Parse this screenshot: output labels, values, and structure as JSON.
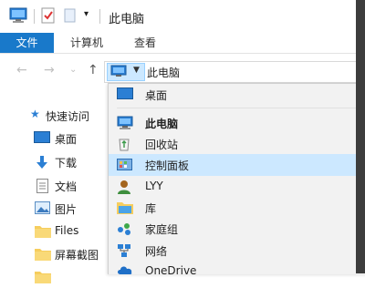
{
  "window": {
    "title": "此电脑"
  },
  "ribbon": {
    "tabs": [
      {
        "label": "文件"
      },
      {
        "label": "计算机"
      },
      {
        "label": "查看"
      }
    ]
  },
  "address": {
    "path": "此电脑"
  },
  "nav_pane": {
    "items": [
      {
        "label": "快速访问",
        "icon": "star-icon"
      },
      {
        "label": "桌面",
        "icon": "desktop-icon"
      },
      {
        "label": "下载",
        "icon": "download-icon"
      },
      {
        "label": "文档",
        "icon": "document-icon"
      },
      {
        "label": "图片",
        "icon": "picture-icon"
      },
      {
        "label": "Files",
        "icon": "folder-icon"
      },
      {
        "label": "屏幕截图",
        "icon": "folder-icon"
      }
    ]
  },
  "dropdown": {
    "items": [
      {
        "label": "桌面",
        "icon": "desktop-icon",
        "bold": false,
        "highlighted": false
      },
      {
        "label": "此电脑",
        "icon": "computer-icon",
        "bold": true,
        "highlighted": false
      },
      {
        "label": "回收站",
        "icon": "recycle-bin-icon",
        "bold": false,
        "highlighted": false
      },
      {
        "label": "控制面板",
        "icon": "control-panel-icon",
        "bold": false,
        "highlighted": true
      },
      {
        "label": "LYY",
        "icon": "user-icon",
        "bold": false,
        "highlighted": false
      },
      {
        "label": "库",
        "icon": "library-icon",
        "bold": false,
        "highlighted": false
      },
      {
        "label": "家庭组",
        "icon": "homegroup-icon",
        "bold": false,
        "highlighted": false
      },
      {
        "label": "网络",
        "icon": "network-icon",
        "bold": false,
        "highlighted": false
      },
      {
        "label": "OneDrive",
        "icon": "onedrive-icon",
        "bold": false,
        "highlighted": false
      }
    ]
  },
  "colors": {
    "accent": "#1979ca",
    "highlight": "#cce8ff",
    "folder": "#f6cd5d"
  }
}
